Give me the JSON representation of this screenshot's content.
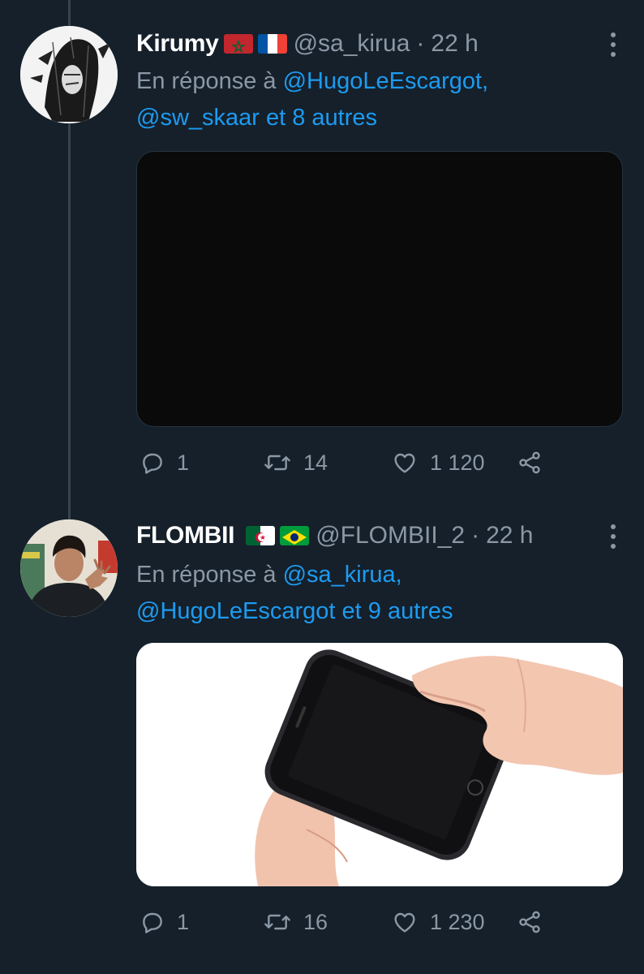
{
  "tweets": [
    {
      "name": "Kirumy",
      "flags": [
        "morocco-flag",
        "france-flag"
      ],
      "handle": "@sa_kirua",
      "separator": "·",
      "time": "22 h",
      "reply_prefix": "En réponse à",
      "reply_mention": "@HugoLeEscargot,",
      "reply_line2_mention": "@sw_skaar",
      "reply_line2_suffix": "et 8 autres",
      "media_desc": "black-image",
      "replies": "1",
      "retweets": "14",
      "likes": "1 120"
    },
    {
      "name": "FLOMBII",
      "flags": [
        "algeria-flag",
        "brazil-flag"
      ],
      "handle": "@FLOMBII_2",
      "separator": "·",
      "time": "22 h",
      "reply_prefix": "En réponse à",
      "reply_mention": "@sa_kirua,",
      "reply_line2_mention": "@HugoLeEscargot",
      "reply_line2_suffix": "et 9 autres",
      "media_desc": "hands-holding-black-smartphone-photo",
      "replies": "1",
      "retweets": "16",
      "likes": "1 230"
    }
  ],
  "colors": {
    "background": "#15202b",
    "secondary_text": "#8b98a5",
    "link": "#1d9bf0",
    "thread_line": "#38444d"
  },
  "icons": [
    "reply-icon",
    "retweet-icon",
    "like-icon",
    "share-icon",
    "more-icon"
  ]
}
